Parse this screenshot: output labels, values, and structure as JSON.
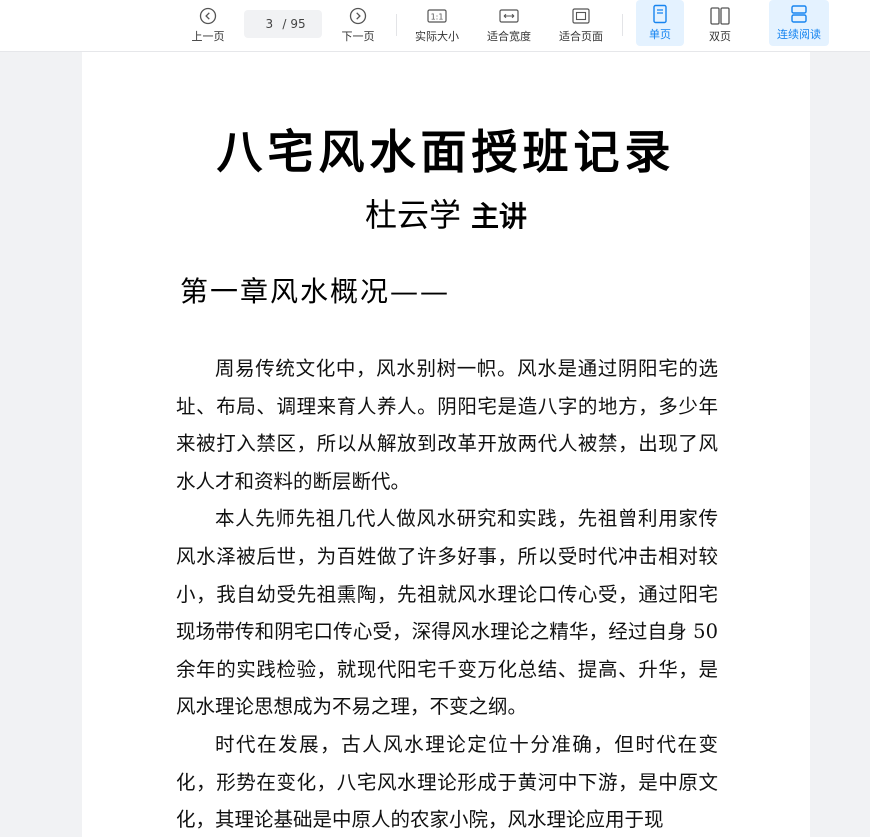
{
  "toolbar": {
    "prev_label": "上一页",
    "current_page": "3",
    "page_sep": "/",
    "total_pages": "95",
    "next_label": "下一页",
    "actual_size_label": "实际大小",
    "actual_size_icon_text": "1:1",
    "fit_width_label": "适合宽度",
    "fit_page_label": "适合页面",
    "single_label": "单页",
    "double_label": "双页",
    "continuous_label": "连续阅读",
    "accent_color": "#1684f0"
  },
  "document": {
    "title": "八宅风水面授班记录",
    "author": "杜云学",
    "author_role": "主讲",
    "chapter": "第一章风水概况——",
    "paragraphs": [
      "周易传统文化中，风水别树一帜。风水是通过阴阳宅的选址、布局、调理来育人养人。阴阳宅是造八字的地方，多少年来被打入禁区，所以从解放到改革开放两代人被禁，出现了风水人才和资料的断层断代。",
      "本人先师先祖几代人做风水研究和实践，先祖曾利用家传风水泽被后世，为百姓做了许多好事，所以受时代冲击相对较小，我自幼受先祖熏陶，先祖就风水理论口传心受，通过阳宅现场带传和阴宅口传心受，深得风水理论之精华，经过自身 50 余年的实践检验，就现代阳宅千变万化总结、提高、升华，是风水理论思想成为不易之理，不变之纲。",
      "时代在发展，古人风水理论定位十分准确，但时代在变化，形势在变化，八宅风水理论形成于黄河中下游，是中原文化，其理论基础是中原人的农家小院，风水理论应用于现"
    ]
  }
}
